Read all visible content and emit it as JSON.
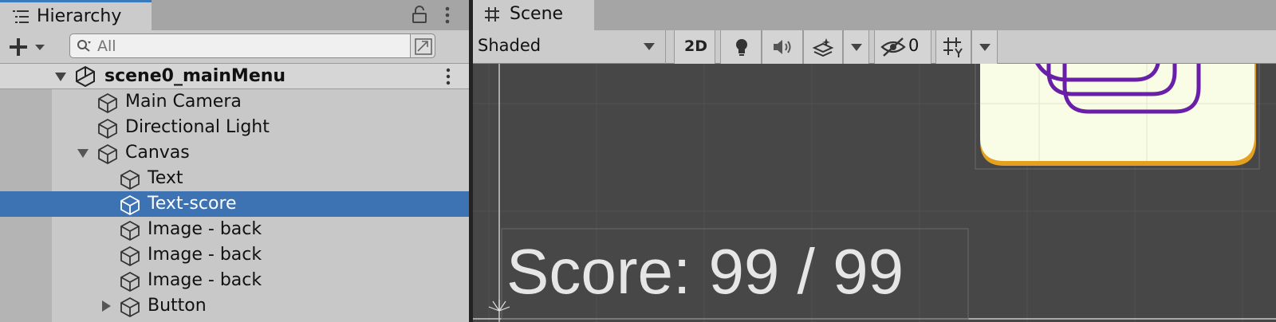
{
  "hierarchy": {
    "tab_label": "Hierarchy",
    "search": {
      "placeholder": "All",
      "value": ""
    },
    "scene_root": "scene0_mainMenu",
    "items": [
      {
        "label": "Main Camera"
      },
      {
        "label": "Directional Light"
      },
      {
        "label": "Canvas"
      },
      {
        "label": "Text"
      },
      {
        "label": "Text-score"
      },
      {
        "label": "Image - back"
      },
      {
        "label": "Image - back"
      },
      {
        "label": "Image - back"
      },
      {
        "label": "Button"
      }
    ],
    "selected_item": "Text-score"
  },
  "scene": {
    "tab_label": "Scene",
    "toolbar": {
      "shading_mode": "Shaded",
      "mode_2d_label": "2D",
      "hidden_count": "0"
    },
    "viewport": {
      "score_text": "Score: 99 / 99"
    }
  },
  "colors": {
    "selection": "#3d72b3",
    "viewport_bg": "#474747",
    "card_fill": "#fafde6",
    "card_border": "#e6a020",
    "rings": "#6a1fa8"
  },
  "icons": [
    "list-icon",
    "lock-icon",
    "kebab-menu-icon",
    "plus-icon",
    "search-icon",
    "unity-scene-icon",
    "gameobject-cube-icon",
    "grid-hash-icon",
    "lightbulb-icon",
    "speaker-icon",
    "effects-icon",
    "hidden-eye-icon",
    "grid-snap-icon"
  ]
}
